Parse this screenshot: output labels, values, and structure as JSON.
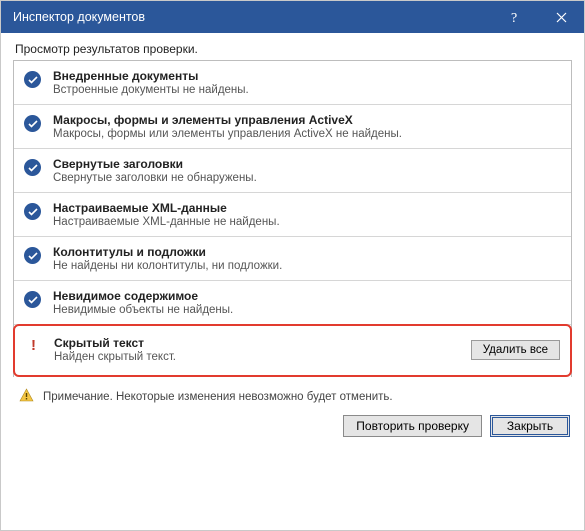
{
  "title": "Инспектор документов",
  "subtitle": "Просмотр результатов проверки.",
  "rows": [
    {
      "title": "Внедренные документы",
      "desc": "Встроенные документы не найдены."
    },
    {
      "title": "Макросы, формы и элементы управления ActiveX",
      "desc": "Макросы, формы или элементы управления ActiveX не найдены."
    },
    {
      "title": "Свернутые заголовки",
      "desc": "Свернутые заголовки не обнаружены."
    },
    {
      "title": "Настраиваемые XML-данные",
      "desc": "Настраиваемые XML-данные не найдены."
    },
    {
      "title": "Колонтитулы и подложки",
      "desc": "Не найдены ни колонтитулы, ни подложки."
    },
    {
      "title": "Невидимое содержимое",
      "desc": "Невидимые объекты не найдены."
    }
  ],
  "alert": {
    "title": "Скрытый текст",
    "desc": "Найден скрытый текст.",
    "button": "Удалить все"
  },
  "note": "Примечание. Некоторые изменения невозможно будет отменить.",
  "buttons": {
    "reinspect": "Повторить проверку",
    "close": "Закрыть"
  }
}
